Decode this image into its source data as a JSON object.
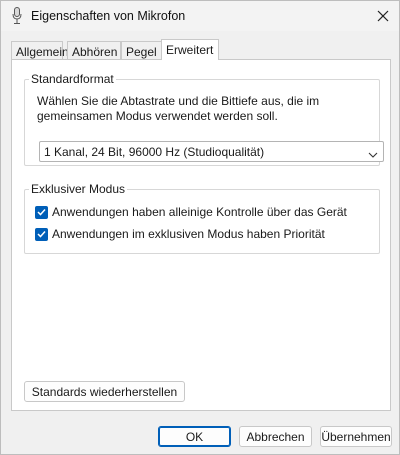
{
  "window": {
    "title": "Eigenschaften von Mikrofon",
    "icon": "microphone-icon",
    "close_icon": "close-icon"
  },
  "tabs": [
    {
      "label": "Allgemein",
      "active": false
    },
    {
      "label": "Abhören",
      "active": false
    },
    {
      "label": "Pegel",
      "active": false
    },
    {
      "label": "Erweitert",
      "active": true
    }
  ],
  "standardformat": {
    "legend": "Standardformat",
    "description": "Wählen Sie die Abtastrate und die Bittiefe aus, die im gemeinsamen Modus verwendet werden soll.",
    "selected": "1 Kanal, 24 Bit, 96000 Hz (Studioqualität)"
  },
  "exclusive": {
    "legend": "Exklusiver Modus",
    "options": [
      {
        "label": "Anwendungen haben alleinige Kontrolle über das Gerät",
        "checked": true
      },
      {
        "label": "Anwendungen im exklusiven Modus haben Priorität",
        "checked": true
      }
    ]
  },
  "buttons": {
    "restore_defaults": "Standards wiederherstellen",
    "ok": "OK",
    "cancel": "Abbrechen",
    "apply": "Übernehmen"
  },
  "colors": {
    "accent": "#005fb8",
    "window_bg": "#f0f0f0",
    "panel_bg": "#ffffff"
  }
}
